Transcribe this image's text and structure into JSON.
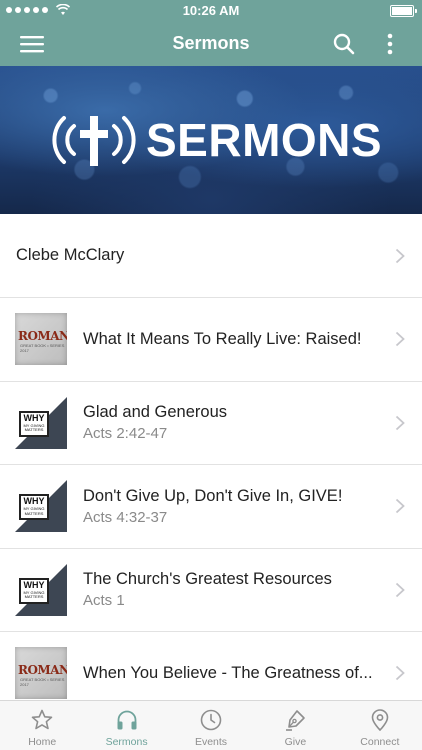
{
  "status_bar": {
    "time": "10:26 AM"
  },
  "nav": {
    "title": "Sermons"
  },
  "banner": {
    "text": "SERMONS"
  },
  "list": {
    "plain_item": {
      "title": "Clebe McClary"
    },
    "items": [
      {
        "title": "What It Means To Really Live:  Raised!",
        "subtitle": "",
        "thumb": "romans"
      },
      {
        "title": "Glad and Generous",
        "subtitle": "Acts 2:42-47",
        "thumb": "why"
      },
      {
        "title": "Don't Give Up, Don't Give In, GIVE!",
        "subtitle": "Acts 4:32-37",
        "thumb": "why"
      },
      {
        "title": "The Church's Greatest Resources",
        "subtitle": "Acts 1",
        "thumb": "why"
      },
      {
        "title": "When You Believe - The Greatness of...",
        "subtitle": "",
        "thumb": "romans"
      }
    ]
  },
  "thumbs": {
    "romans": {
      "title": "ROMANS",
      "caption": "GREAT BOOK • SERIES 2017"
    },
    "why": {
      "title": "WHY",
      "caption_line1": "MY GIVING",
      "caption_line2": "MATTERS"
    }
  },
  "tabs": [
    {
      "label": "Home",
      "icon": "star-icon",
      "active": false
    },
    {
      "label": "Sermons",
      "icon": "headphones-icon",
      "active": true
    },
    {
      "label": "Events",
      "icon": "clock-icon",
      "active": false
    },
    {
      "label": "Give",
      "icon": "pen-icon",
      "active": false
    },
    {
      "label": "Connect",
      "icon": "map-pin-icon",
      "active": false
    }
  ],
  "colors": {
    "accent": "#6fa39b",
    "banner": "#28508e",
    "inactive_tab": "#8e8e8e"
  }
}
